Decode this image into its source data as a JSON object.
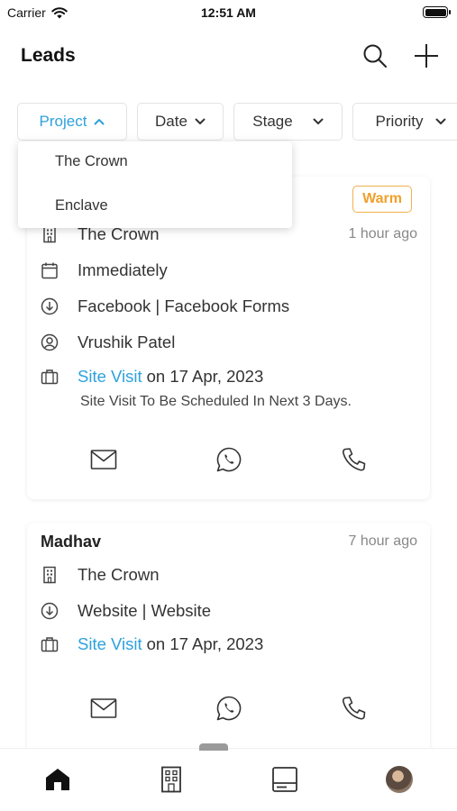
{
  "status_bar": {
    "carrier": "Carrier",
    "time": "12:51 AM"
  },
  "header": {
    "title": "Leads",
    "icons": [
      "search-icon",
      "add-icon"
    ]
  },
  "filters": [
    {
      "label": "Project",
      "state": "expanded"
    },
    {
      "label": "Date",
      "state": "collapsed"
    },
    {
      "label": "Stage",
      "state": "collapsed"
    },
    {
      "label": "Priority",
      "state": "collapsed"
    }
  ],
  "project_dropdown": {
    "options": [
      "The Crown",
      "Enclave"
    ]
  },
  "leads": [
    {
      "badge": "Warm",
      "project": "The Crown",
      "time_ago": "1 hour ago",
      "timeline": "Immediately",
      "source": "Facebook | Facebook Forms",
      "owner": "Vrushik Patel",
      "activity_type": "Site Visit",
      "activity_date": "on 17 Apr, 2023",
      "note": "Site Visit To Be Scheduled In Next 3 Days."
    },
    {
      "name": "Madhav",
      "time_ago": "7 hour ago",
      "project": "The Crown",
      "source": "Website | Website",
      "activity_type": "Site Visit",
      "activity_date": "on 17 Apr, 2023"
    }
  ],
  "bottom_nav": {
    "items": [
      "home-icon",
      "building-icon",
      "inventory-icon",
      "avatar"
    ]
  },
  "colors": {
    "accent": "#2ea1dc",
    "warm": "#f0a02c"
  }
}
